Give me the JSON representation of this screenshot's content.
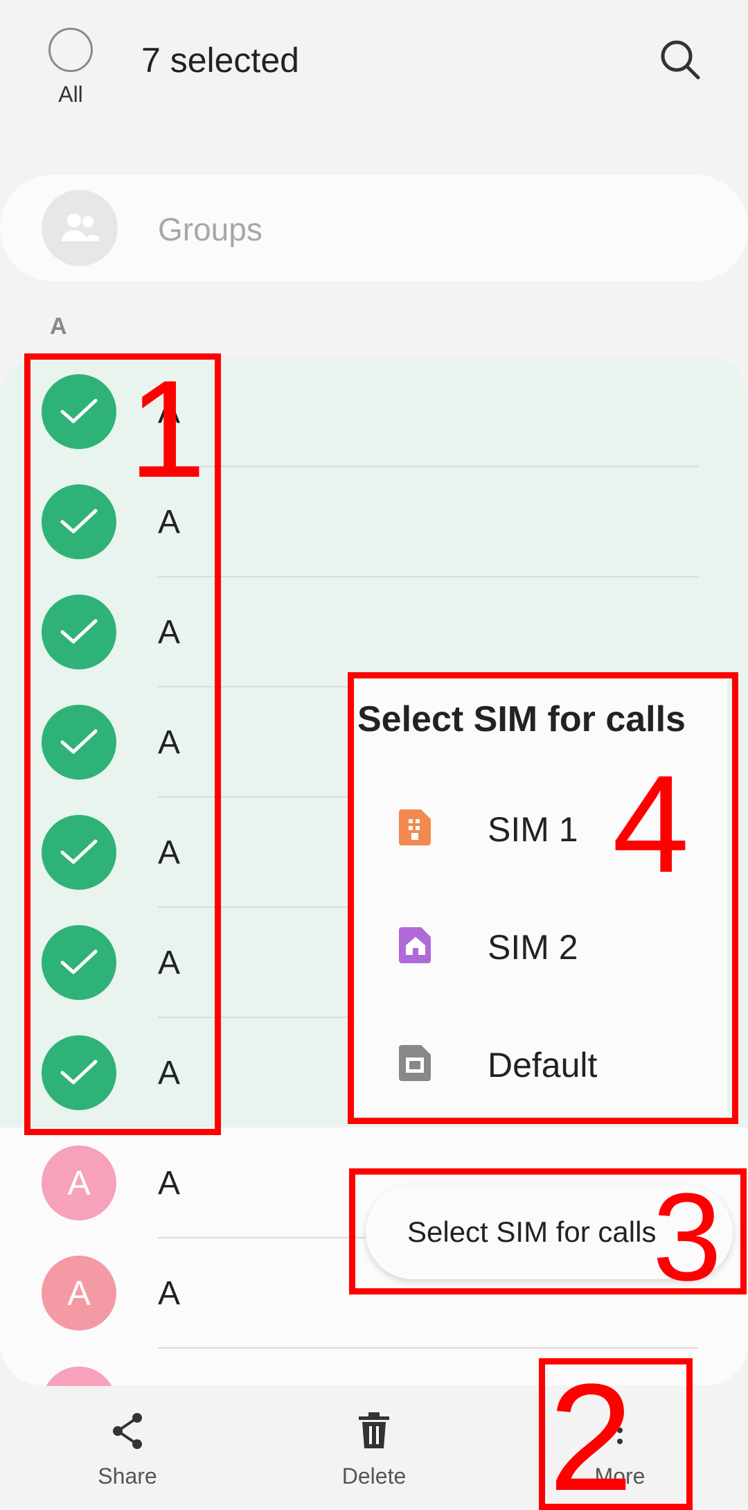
{
  "header": {
    "all_label": "All",
    "selected_count": "7 selected"
  },
  "groups": {
    "label": "Groups"
  },
  "section_letter": "A",
  "contacts": [
    {
      "name": "A",
      "checked": true
    },
    {
      "name": "A",
      "checked": true
    },
    {
      "name": "A",
      "checked": true
    },
    {
      "name": "A",
      "checked": true
    },
    {
      "name": "A",
      "checked": true
    },
    {
      "name": "A",
      "checked": true
    },
    {
      "name": "A",
      "checked": true
    },
    {
      "name": "A",
      "checked": false,
      "avatar_letter": "A"
    },
    {
      "name": "A",
      "checked": false,
      "avatar_letter": "A"
    }
  ],
  "sim_popup": {
    "title": "Select SIM for calls",
    "items": [
      {
        "label": "SIM 1",
        "icon": "sim1-icon",
        "color": "#f28a50"
      },
      {
        "label": "SIM 2",
        "icon": "sim2-icon",
        "color": "#b06ad8"
      },
      {
        "label": "Default",
        "icon": "default-sim-icon",
        "color": "#888888"
      }
    ]
  },
  "sim_chip": {
    "label": "Select SIM for calls"
  },
  "bottom_bar": {
    "share_label": "Share",
    "delete_label": "Delete",
    "more_label": "More"
  },
  "annotations": [
    "1",
    "2",
    "3",
    "4"
  ],
  "colors": {
    "selected_green": "#2fb277",
    "selected_bg": "#e8f4ed",
    "annotation_red": "#ff0000"
  }
}
